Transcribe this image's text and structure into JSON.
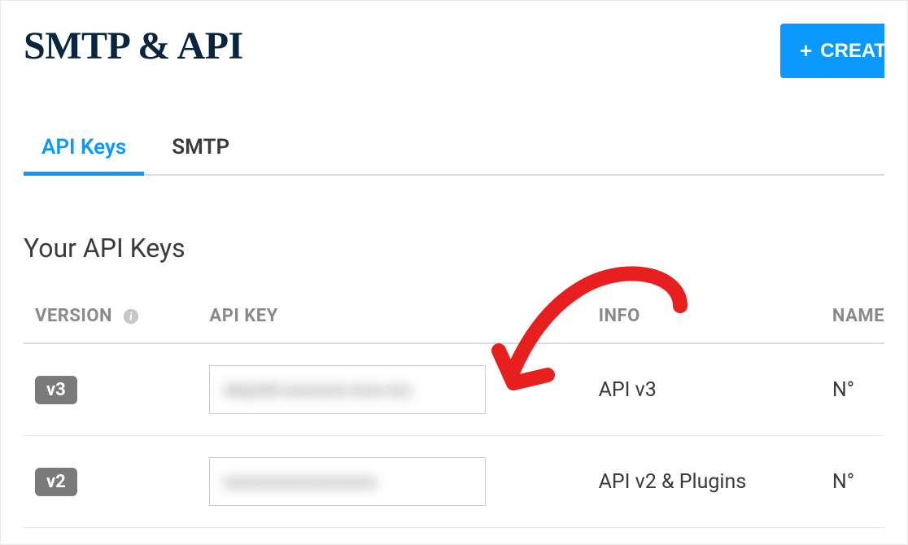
{
  "header": {
    "title": "SMTP & API",
    "create_label": "CREATE A NEW API KEY"
  },
  "tabs": {
    "api_keys": "API Keys",
    "smtp": "SMTP"
  },
  "section": {
    "title": "Your API Keys"
  },
  "table": {
    "headers": {
      "version": "VERSION",
      "api_key": "API KEY",
      "info": "INFO",
      "name": "NAME"
    },
    "rows": [
      {
        "version": "v3",
        "key_masked": "xkeysib-xxxxxxxx-xxxx-xxx",
        "info": "API v3",
        "name": "N°"
      },
      {
        "version": "v2",
        "key_masked": "xxxxxxxxxxxxxxxxxxx",
        "info": "API v2 & Plugins",
        "name": "N°"
      }
    ]
  }
}
